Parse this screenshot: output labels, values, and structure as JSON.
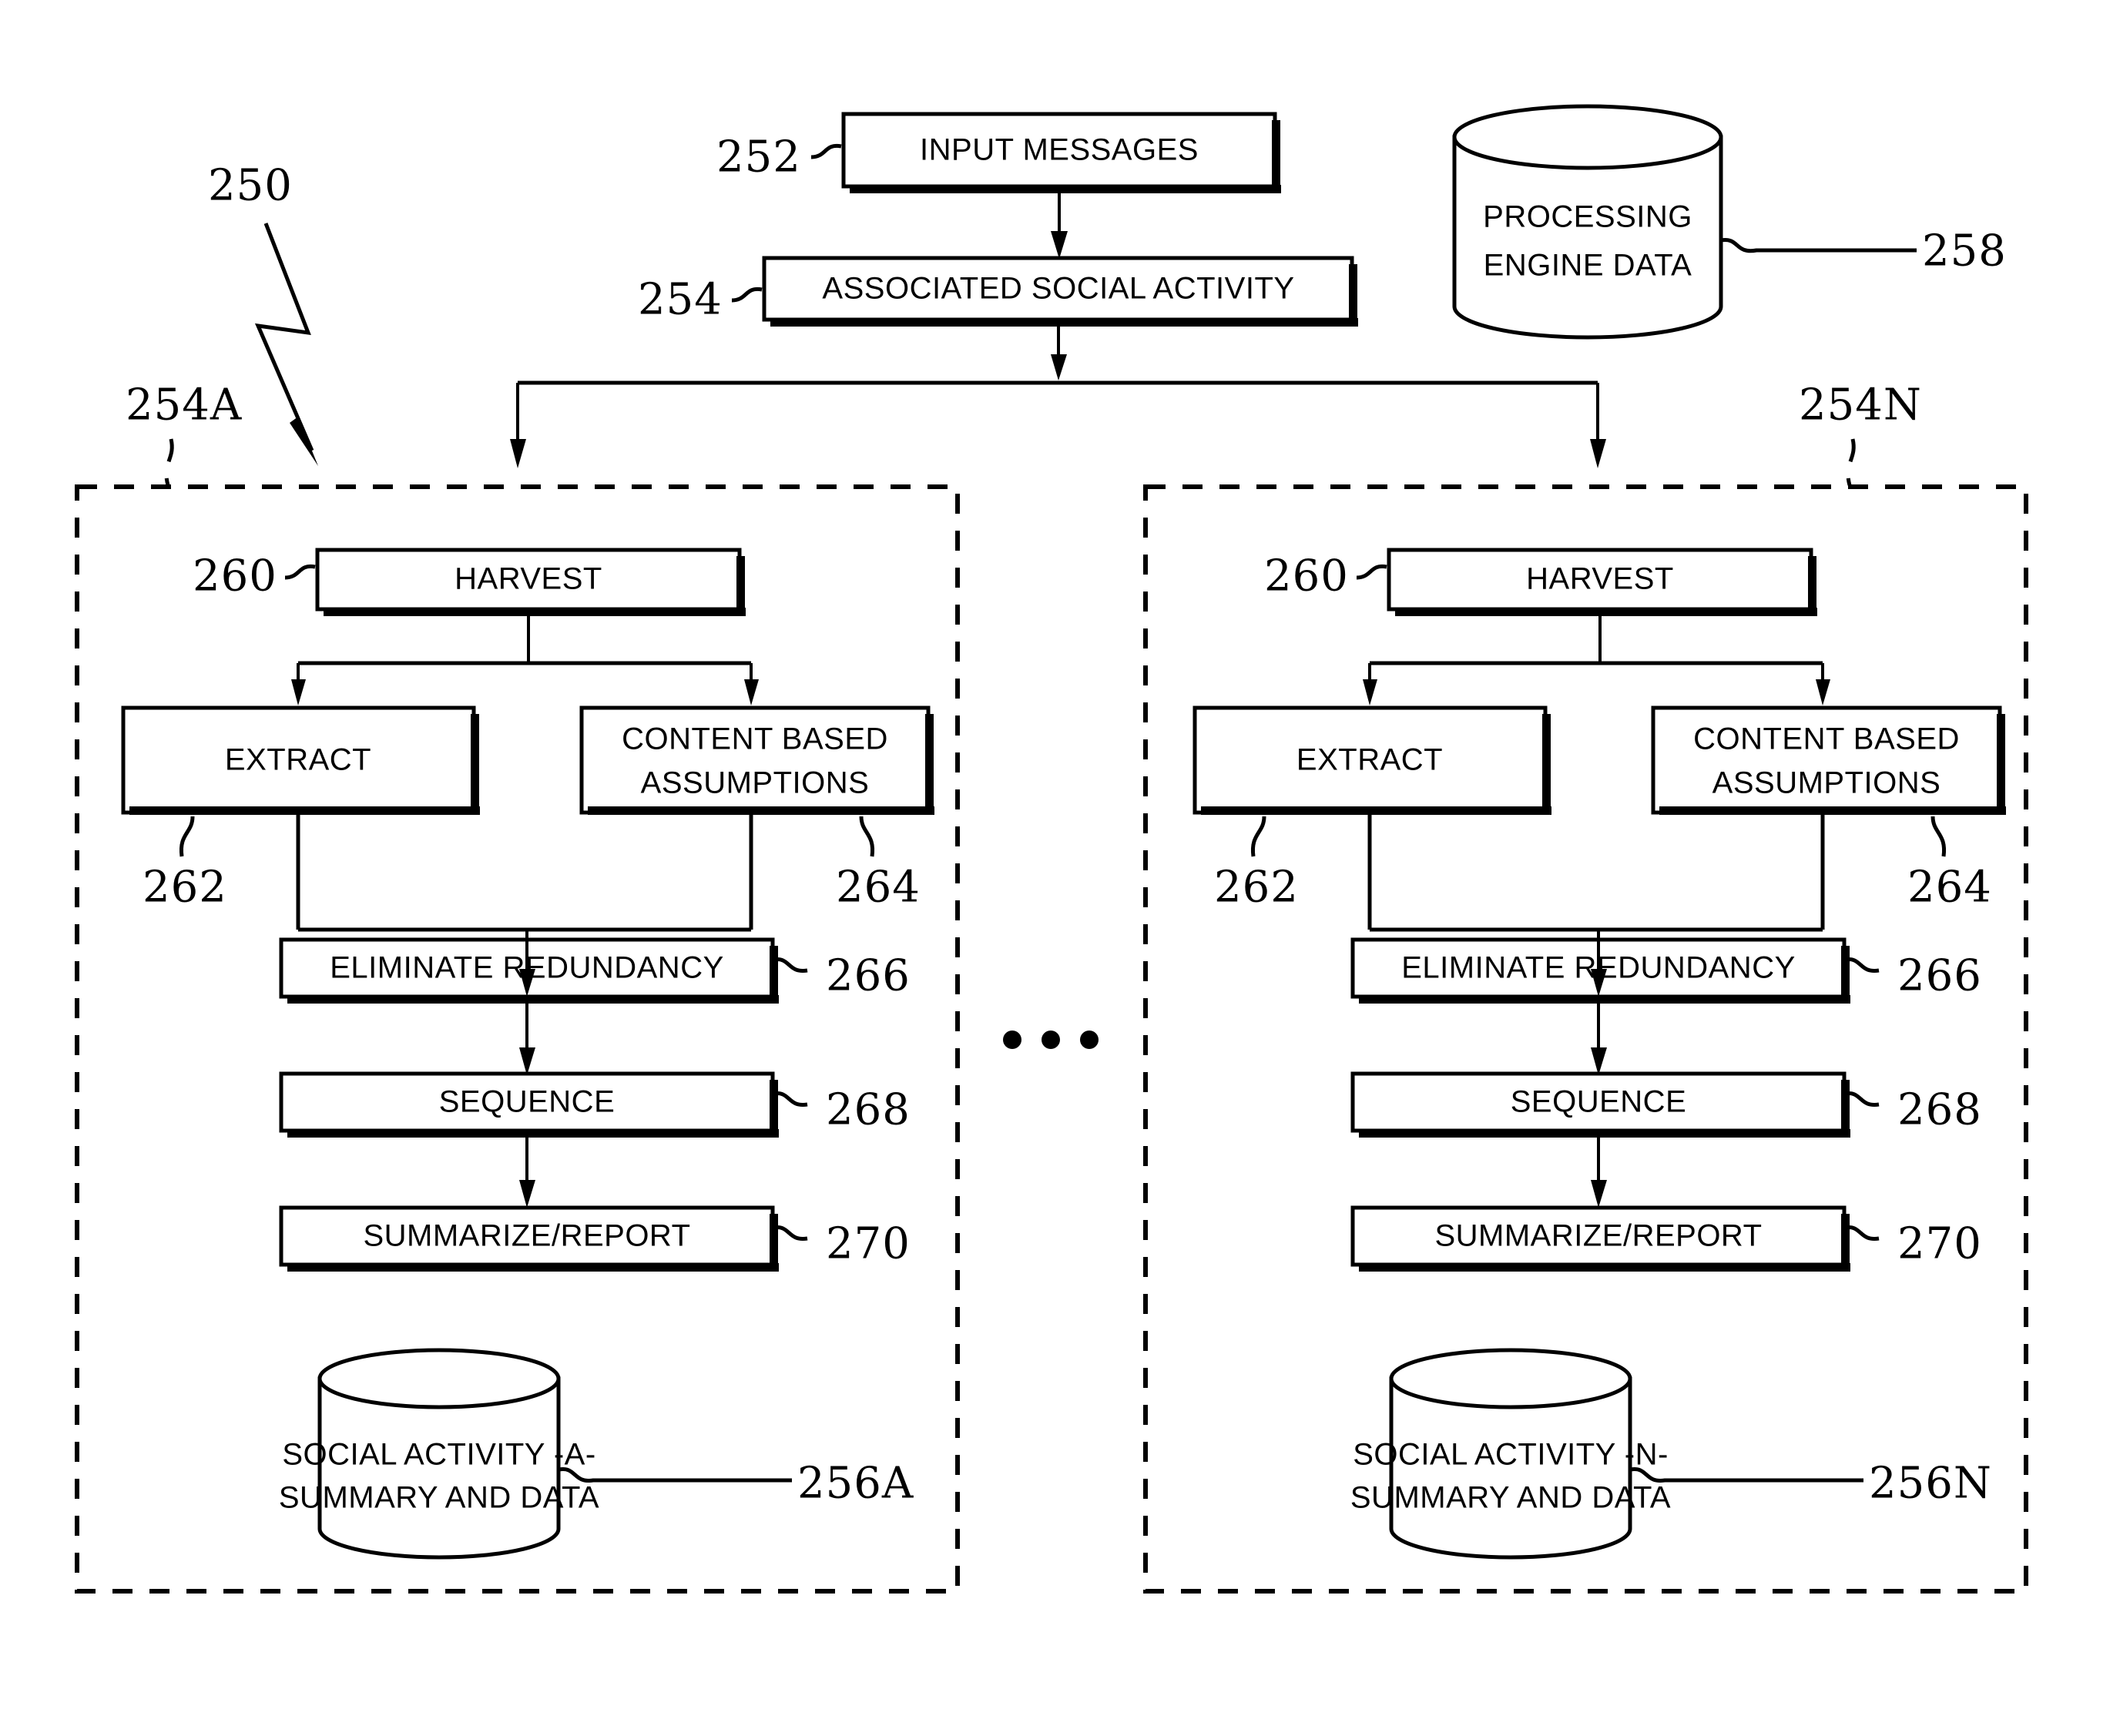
{
  "figure": {
    "id": "250",
    "type": "patent-flow-diagram",
    "title_numeral": "250"
  },
  "top_flow": {
    "input_messages": {
      "label": "INPUT MESSAGES",
      "ref": "252"
    },
    "associated_social_activity": {
      "label": "ASSOCIATED SOCIAL ACTIVITY",
      "ref": "254"
    },
    "processing_engine_data": {
      "label_line1": "PROCESSING",
      "label_line2": "ENGINE DATA",
      "ref": "258"
    }
  },
  "ellipsis": "• • •",
  "panels": [
    {
      "ref": "254A",
      "steps": [
        {
          "label": "HARVEST",
          "ref": "260"
        },
        {
          "label": "EXTRACT",
          "ref": "262"
        },
        {
          "label_line1": "CONTENT BASED",
          "label_line2": "ASSUMPTIONS",
          "ref": "264"
        },
        {
          "label": "ELIMINATE REDUNDANCY",
          "ref": "266"
        },
        {
          "label": "SEQUENCE",
          "ref": "268"
        },
        {
          "label": "SUMMARIZE/REPORT",
          "ref": "270"
        }
      ],
      "store": {
        "label_line1": "SOCIAL ACTIVITY -A-",
        "label_line2": "SUMMARY AND DATA",
        "ref": "256A"
      }
    },
    {
      "ref": "254N",
      "steps": [
        {
          "label": "HARVEST",
          "ref": "260"
        },
        {
          "label": "EXTRACT",
          "ref": "262"
        },
        {
          "label_line1": "CONTENT BASED",
          "label_line2": "ASSUMPTIONS",
          "ref": "264"
        },
        {
          "label": "ELIMINATE REDUNDANCY",
          "ref": "266"
        },
        {
          "label": "SEQUENCE",
          "ref": "268"
        },
        {
          "label": "SUMMARIZE/REPORT",
          "ref": "270"
        }
      ],
      "store": {
        "label_line1": "SOCIAL ACTIVITY -N-",
        "label_line2": "SUMMARY AND DATA",
        "ref": "256N"
      }
    }
  ],
  "colors": {
    "ink": "#000000",
    "paper": "#ffffff"
  }
}
